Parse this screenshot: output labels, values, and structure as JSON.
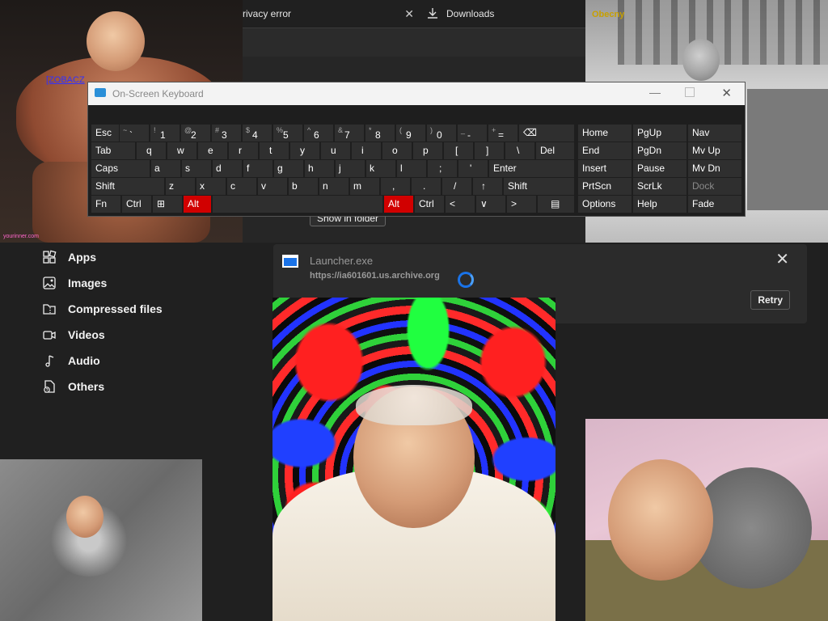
{
  "browser": {
    "tab1_title": "rivacy error",
    "tab2_title": "Downloads",
    "show_in_folder": "Show in folder"
  },
  "sidebar": {
    "items": [
      {
        "label": "Apps"
      },
      {
        "label": "Images"
      },
      {
        "label": "Compressed files"
      },
      {
        "label": "Videos"
      },
      {
        "label": "Audio"
      },
      {
        "label": "Others"
      }
    ]
  },
  "download": {
    "filename": "Launcher.exe",
    "url": "https://ia601601.us.archive.org",
    "retry": "Retry"
  },
  "overlay": {
    "link_text": "[ZOBACZ",
    "watermark": "yourinner.com",
    "tv_logo": "Obecny"
  },
  "osk": {
    "title": "On-Screen Keyboard",
    "row1": [
      "Esc",
      "`",
      "1",
      "2",
      "3",
      "4",
      "5",
      "6",
      "7",
      "8",
      "9",
      "0",
      "-",
      "=",
      "⌫"
    ],
    "row1_top": [
      "~",
      "!",
      "@",
      "#",
      "$",
      "%",
      "^",
      "&",
      "*",
      "(",
      ")",
      "_",
      "+"
    ],
    "row2": [
      "Tab",
      "q",
      "w",
      "e",
      "r",
      "t",
      "y",
      "u",
      "i",
      "o",
      "p",
      "[",
      "]",
      "\\",
      "Del"
    ],
    "row3": [
      "Caps",
      "a",
      "s",
      "d",
      "f",
      "g",
      "h",
      "j",
      "k",
      "l",
      ";",
      "'",
      "Enter"
    ],
    "row4": [
      "Shift",
      "z",
      "x",
      "c",
      "v",
      "b",
      "n",
      "m",
      ",",
      ".",
      "/",
      "↑",
      "Shift"
    ],
    "row5": [
      "Fn",
      "Ctrl",
      "⊞",
      "Alt",
      "Alt",
      "Ctrl",
      "<",
      "∨",
      ">",
      "▤"
    ],
    "right": [
      [
        "Home",
        "PgUp",
        "Nav"
      ],
      [
        "End",
        "PgDn",
        "Mv Up"
      ],
      [
        "Insert",
        "Pause",
        "Mv Dn"
      ],
      [
        "PrtScn",
        "ScrLk",
        "Dock"
      ],
      [
        "Options",
        "Help",
        "Fade"
      ]
    ]
  }
}
